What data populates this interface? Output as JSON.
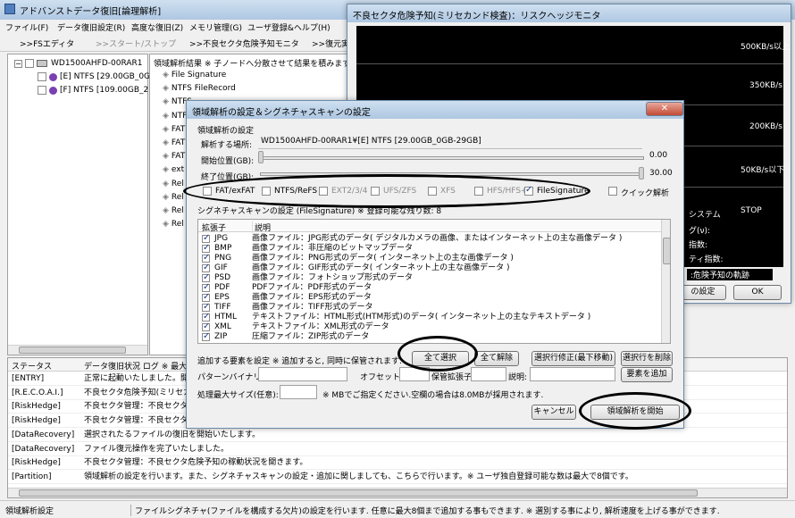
{
  "main": {
    "title": "アドバンストデータ復旧[論理解析]",
    "menu": [
      "ファイル(F)",
      "データ復旧設定(R)",
      "高度な復旧(Z)",
      "メモリ管理(G)",
      "ユーザ登録&ヘルプ(H)"
    ],
    "toolbar": [
      ">>FSエディタ",
      ">>スタート/ストップ",
      ">>不良セクタ危険予知モニタ",
      ">>復元実"
    ],
    "tree": {
      "disk": "WD1500AHFD-00RAR1",
      "parts": [
        "[E] NTFS [29.00GB_0GI",
        "[F] NTFS [109.00GB_2"
      ]
    },
    "analysis_header": "領域解析結果 ※ 子ノードへ分散させて結果を積みます。",
    "analysis_items": [
      "File Signature",
      "NTFS FileRecord",
      "NTFS",
      "NTF",
      "FAT",
      "FAT",
      "FAT",
      "ext",
      "Rel",
      "Rel",
      "Rel",
      "Rel"
    ],
    "log_header": {
      "status": "ステータス",
      "desc": "データ復旧状況 ログ ※ 最大2"
    },
    "log_rows": [
      {
        "s": "[ENTRY]",
        "d": "正常に起動いたしました。開"
      },
      {
        "s": "[R.E.C.O.A.I.]",
        "d": "不良セクタ危険予知(ミリセカ"
      },
      {
        "s": "[RiskHedge]",
        "d": "不良セクタ管理：不良セクタ"
      },
      {
        "s": "[RiskHedge]",
        "d": "不良セクタ管理：不良セクタ"
      },
      {
        "s": "[DataRecovery]",
        "d": "選択されたるファイルの復旧を開始いたします。"
      },
      {
        "s": "[DataRecovery]",
        "d": "ファイル復元操作を完了いたしました。"
      },
      {
        "s": "[RiskHedge]",
        "d": "不良セクタ管理：不良セクタ危険予知の稼動状況を開きます。"
      },
      {
        "s": "[Partition]",
        "d": "領域解析の設定を行います。また、シグネチャスキャンの設定・追加に関しましても、こちらで行います。※ ユーザ独自登録可能な数は最大で8個です。"
      }
    ],
    "statusbar": {
      "left": "領域解析設定",
      "right": "ファイルシグネチャ(ファイルを構成する欠片)の設定を行います. 任意に最大8個まで追加する事もできます. ※ 選別する事により, 解析速度を上げる事ができます."
    }
  },
  "monitor": {
    "title": "不良セクタ危険予知(ミリセカンド検査)：リスクヘッジモニタ",
    "scale": [
      "500KB/s以上",
      "350KB/s",
      "200KB/s",
      "50KB/s以下"
    ],
    "sys": "システム",
    "stop": "STOP",
    "info": [
      "グ(ν):",
      "指数:",
      "ティ指数:"
    ],
    "legend": ":危険予知の軌跡",
    "settings_button": "の設定",
    "ok_button": "OK"
  },
  "dialog": {
    "title": "領域解析の設定＆シグネチャスキャンの設定",
    "close_icon": "✕",
    "group_label": "領域解析の設定",
    "location_label": "解析する場所:",
    "location_value": "WD1500AHFD-00RAR1¥[E] NTFS [29.00GB_0GB-29GB]",
    "start_label": "開始位置(GB):",
    "start_value": "0.00",
    "end_label": "終了位置(GB):",
    "end_value": "30.00",
    "fs_options": [
      {
        "label": "FAT/exFAT",
        "checked": false,
        "enabled": true
      },
      {
        "label": "NTFS/ReFS",
        "checked": false,
        "enabled": true
      },
      {
        "label": "EXT2/3/4",
        "checked": false,
        "enabled": false
      },
      {
        "label": "UFS/ZFS",
        "checked": false,
        "enabled": false
      },
      {
        "label": "XFS",
        "checked": false,
        "enabled": false
      },
      {
        "label": "HFS/HFS+",
        "checked": false,
        "enabled": false
      },
      {
        "label": "FileSignature",
        "checked": true,
        "enabled": true
      }
    ],
    "quick_label": "クイック解析",
    "sig_label": "シグネチャスキャンの設定 (FileSignature) ※ 登録可能な残り数: 8",
    "col_ext": "拡張子",
    "col_desc": "説明",
    "rows": [
      {
        "ext": "JPG",
        "desc": "画像ファイル：JPG形式のデータ( デジタルカメラの画像、またはインターネット上の主な画像データ )"
      },
      {
        "ext": "BMP",
        "desc": "画像ファイル：非圧縮のビットマップデータ"
      },
      {
        "ext": "PNG",
        "desc": "画像ファイル：PNG形式のデータ( インターネット上の主な画像データ )"
      },
      {
        "ext": "GIF",
        "desc": "画像ファイル：GIF形式のデータ( インターネット上の主な画像データ )"
      },
      {
        "ext": "PSD",
        "desc": "画像ファイル：フォトショップ形式のデータ"
      },
      {
        "ext": "PDF",
        "desc": "PDFファイル：PDF形式のデータ"
      },
      {
        "ext": "EPS",
        "desc": "画像ファイル：EPS形式のデータ"
      },
      {
        "ext": "TIFF",
        "desc": "画像ファイル：TIFF形式のデータ"
      },
      {
        "ext": "HTML",
        "desc": "テキストファイル：HTML形式(HTM形式)のデータ( インターネット上の主なテキストデータ )"
      },
      {
        "ext": "XML",
        "desc": "テキストファイル：XML形式のデータ"
      },
      {
        "ext": "ZIP",
        "desc": "圧縮ファイル：ZIP形式のデータ"
      }
    ],
    "add_label": "追加する要素を設定 ※ 追加すると, 同時に保管されます.",
    "select_all": "全て選択",
    "clear_all": "全て解除",
    "edit_row": "選択行修正(最下移動)",
    "delete_row": "選択行を削除",
    "pattern_label": "パターンバイナリ:",
    "offset_label": "オフセット:",
    "save_ext_label": "保管拡張子:",
    "desc_label": "説明:",
    "add_element": "要素を追加",
    "max_size_label": "処理最大サイズ(任意):",
    "max_size_note": "※ MBでご指定ください.空欄の場合は8.0MBが採用されます.",
    "cancel": "キャンセル",
    "start": "領域解析を開始"
  }
}
